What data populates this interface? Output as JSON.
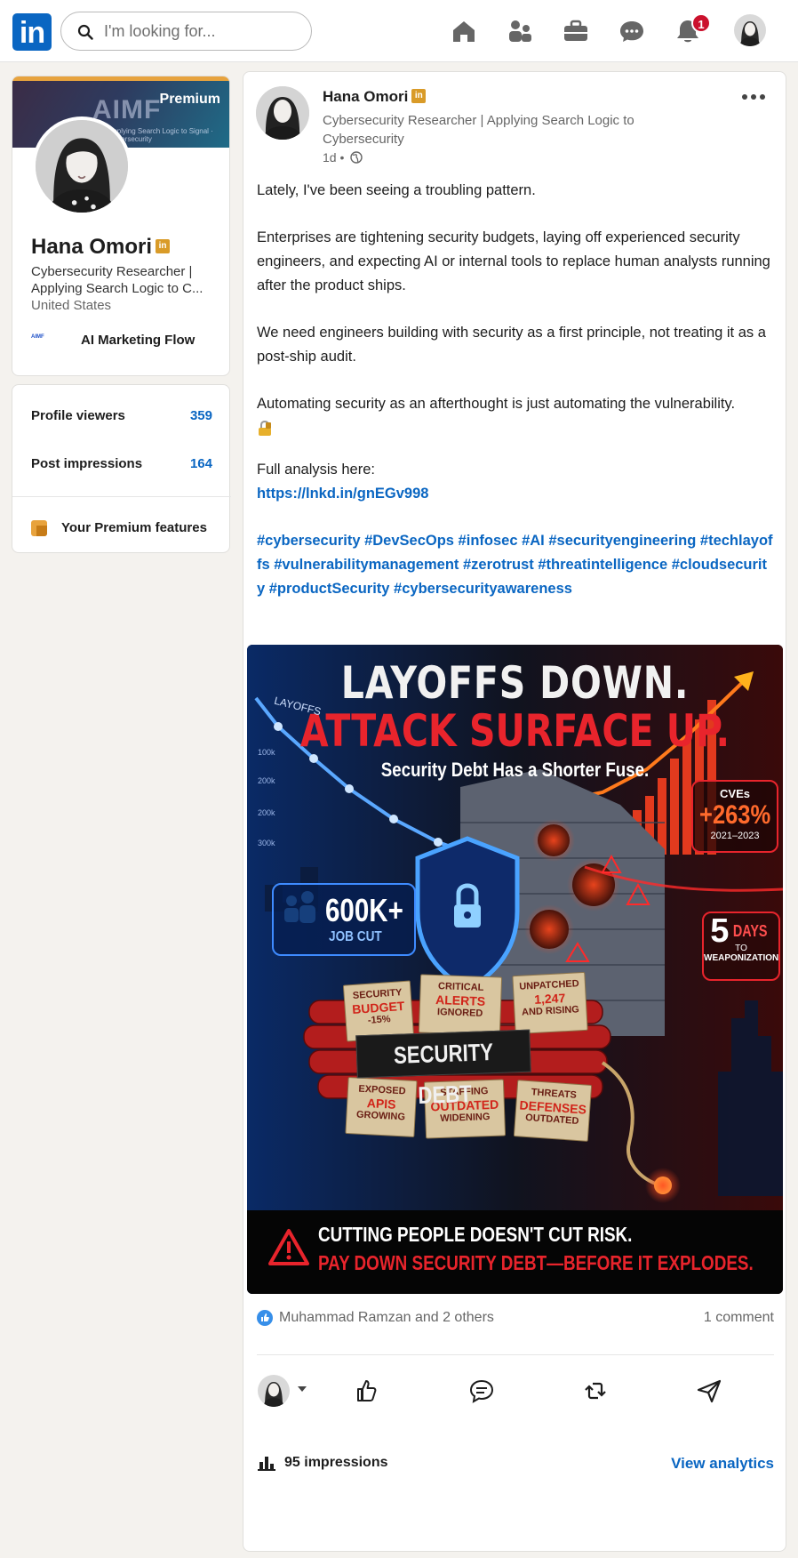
{
  "nav": {
    "logo_text": "in",
    "search_placeholder": "I'm looking for...",
    "notification_count": "1",
    "icons": [
      "home-icon",
      "my-network-icon",
      "jobs-icon",
      "messaging-icon",
      "notifications-icon",
      "profile-avatar"
    ]
  },
  "profile": {
    "premium_label": "Premium",
    "banner_text": "AIMF",
    "banner_sub": "Applying Search Logic to Signal · Cybersecurity",
    "name": "Hana Omori",
    "headline": "Cybersecurity Researcher | Applying Search Logic to C...",
    "location": "United States",
    "company_logo_text": "AIMF",
    "company": "AI Marketing Flow"
  },
  "stats": {
    "profile_viewers_label": "Profile viewers",
    "profile_viewers_value": "359",
    "post_impressions_label": "Post impressions",
    "post_impressions_value": "164",
    "premium_features": "Your Premium features"
  },
  "post": {
    "author": "Hana Omori",
    "headline": "Cybersecurity Researcher | Applying Search Logic to Cybersecurity",
    "time": "1d •",
    "paragraphs": [
      "Lately, I've been seeing a troubling pattern.",
      "Enterprises are tightening security budgets, laying off experienced security engineers, and expecting AI or internal tools to replace human analysts running after the product ships.",
      "We need engineers building with security as a first principle, not treating it as a post-ship audit.",
      "Automating security as an afterthought is just automating the vulnerability."
    ],
    "full_analysis": "Full analysis here:",
    "link": "https://lnkd.in/gnEGv998",
    "hashtags": "#cybersecurity #DevSecOps #infosec #AI #securityengineering #techlayoffs #vulnerabilitymanagement #zerotrust #threatintelligence #cloudsecurity #productSecurity #cybersecurityawareness",
    "image": {
      "title1": "LAYOFFS DOWN.",
      "title2": "ATTACK SURFACE UP.",
      "subtitle": "Security Debt Has a Shorter Fuse.",
      "layoffs_label": "LAYOFFS",
      "axis_ticks": [
        "100k",
        "200k",
        "200k",
        "300k"
      ],
      "jobcut_num": "600K+",
      "jobcut_label": "JOB CUT",
      "cve_label": "CVEs",
      "cve_num": "+263%",
      "cve_years": "2021–2023",
      "days_num": "5",
      "days_label": "DAYS",
      "days_to": "TO",
      "days_weapon": "WEAPONIZATION",
      "debt": "SECURITY DEBT",
      "tags": [
        {
          "top": "SECURITY",
          "main": "BUDGET",
          "bot": "-15%"
        },
        {
          "top": "CRITICAL",
          "main": "ALERTS",
          "bot": "IGNORED"
        },
        {
          "top": "UNPATCHED",
          "main": "1,247",
          "bot": "AND RISING"
        },
        {
          "top": "EXPOSED",
          "main": "APIS",
          "bot": "GROWING"
        },
        {
          "top": "STAFFING",
          "main": "OUTDATED",
          "bot": "WIDENING"
        },
        {
          "top": "THREATS",
          "main": "DEFENSES",
          "bot": "OUTDATED"
        }
      ],
      "bottom_line1": "CUTTING PEOPLE DOESN'T CUT RISK.",
      "bottom_line2": "PAY DOWN SECURITY DEBT—BEFORE IT EXPLODES."
    },
    "reactions": "Muhammad Ramzan and 2 others",
    "comments": "1 comment",
    "impressions": "95 impressions",
    "analytics": "View analytics"
  },
  "colors": {
    "brand": "#0a66c2",
    "premium": "#e7a33e",
    "alert": "#e8242c"
  }
}
